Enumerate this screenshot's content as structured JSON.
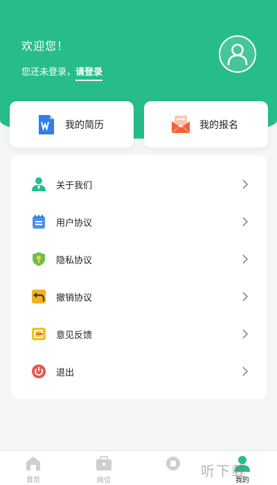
{
  "header": {
    "greeting": "欢迎您！",
    "login_prompt": "您还未登录，",
    "login_link": "请登录",
    "avatar_icon": "user-icon",
    "background_color": "#27bd8a"
  },
  "quick_actions": [
    {
      "label": "我的简历",
      "icon": "resume-doc-icon",
      "color": "#2f7fe8"
    },
    {
      "label": "我的报名",
      "icon": "envelope-icon",
      "color": "#f0613a"
    }
  ],
  "menu": {
    "items": [
      {
        "label": "关于我们",
        "icon": "person-icon",
        "color": "#1fbf90"
      },
      {
        "label": "用户协议",
        "icon": "notepad-icon",
        "color": "#4a8ff0"
      },
      {
        "label": "隐私协议",
        "icon": "shield-key-icon",
        "color": "#6cc04a"
      },
      {
        "label": "撤销协议",
        "icon": "undo-icon",
        "color": "#f2b21d"
      },
      {
        "label": "意见反馈",
        "icon": "feedback-icon",
        "color": "#f2c21d"
      },
      {
        "label": "退出",
        "icon": "power-icon",
        "color": "#e35a4f"
      }
    ]
  },
  "tabbar": {
    "tabs": [
      {
        "label": "首页",
        "icon": "home-icon",
        "active": false
      },
      {
        "label": "岗位",
        "icon": "briefcase-icon",
        "active": false
      },
      {
        "label": "",
        "icon": "tab-icon",
        "active": false
      },
      {
        "label": "我的",
        "icon": "profile-icon",
        "active": true
      }
    ],
    "active_color": "#27bd8a"
  },
  "watermark": "听下载"
}
